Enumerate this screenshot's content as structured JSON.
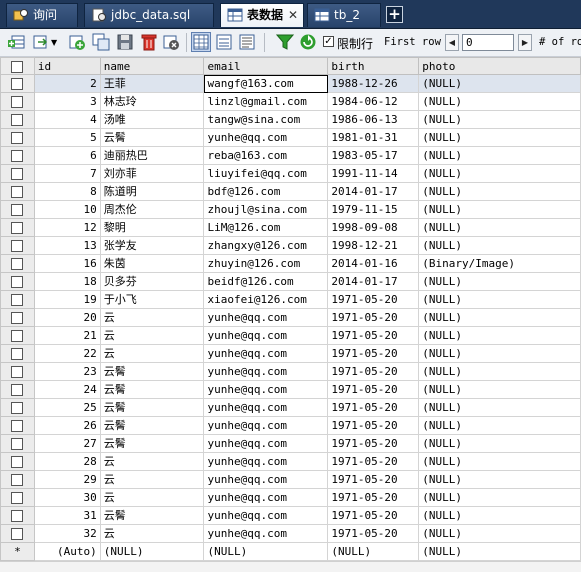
{
  "tabs": [
    {
      "label": "询问",
      "icon": "query-icon",
      "active": false
    },
    {
      "label": "jdbc_data.sql",
      "icon": "sql-file-icon",
      "active": false
    },
    {
      "label": "表数据",
      "icon": "table-data-icon",
      "active": true
    },
    {
      "label": "tb_2",
      "icon": "table-icon",
      "active": false
    }
  ],
  "toolbar": {
    "limit_label": "限制行",
    "first_row_label": "First row",
    "first_row_value": "0",
    "of_rows_label": "# of ro"
  },
  "columns": [
    "id",
    "name",
    "email",
    "birth",
    "photo"
  ],
  "rows": [
    {
      "id": "2",
      "name": "王菲",
      "email": "wangf@163.com",
      "birth": "1988-12-26",
      "photo": "(NULL)"
    },
    {
      "id": "3",
      "name": "林志玲",
      "email": "linzl@gmail.com",
      "birth": "1984-06-12",
      "photo": "(NULL)"
    },
    {
      "id": "4",
      "name": "汤唯",
      "email": "tangw@sina.com",
      "birth": "1986-06-13",
      "photo": "(NULL)"
    },
    {
      "id": "5",
      "name": "云鬌",
      "email": "yunhe@qq.com",
      "birth": "1981-01-31",
      "photo": "(NULL)"
    },
    {
      "id": "6",
      "name": "迪丽热巴",
      "email": "reba@163.com",
      "birth": "1983-05-17",
      "photo": "(NULL)"
    },
    {
      "id": "7",
      "name": "刘亦菲",
      "email": "liuyifei@qq.com",
      "birth": "1991-11-14",
      "photo": "(NULL)"
    },
    {
      "id": "8",
      "name": "陈道明",
      "email": "bdf@126.com",
      "birth": "2014-01-17",
      "photo": "(NULL)"
    },
    {
      "id": "10",
      "name": "周杰伦",
      "email": "zhoujl@sina.com",
      "birth": "1979-11-15",
      "photo": "(NULL)"
    },
    {
      "id": "12",
      "name": "黎明",
      "email": "LiM@126.com",
      "birth": "1998-09-08",
      "photo": "(NULL)"
    },
    {
      "id": "13",
      "name": "张学友",
      "email": "zhangxy@126.com",
      "birth": "1998-12-21",
      "photo": "(NULL)"
    },
    {
      "id": "16",
      "name": "朱茵",
      "email": "zhuyin@126.com",
      "birth": "2014-01-16",
      "photo": "(Binary/Image)"
    },
    {
      "id": "18",
      "name": "贝多芬",
      "email": "beidf@126.com",
      "birth": "2014-01-17",
      "photo": "(NULL)"
    },
    {
      "id": "19",
      "name": "于小飞",
      "email": "xiaofei@126.com",
      "birth": "1971-05-20",
      "photo": "(NULL)"
    },
    {
      "id": "20",
      "name": "云",
      "email": "yunhe@qq.com",
      "birth": "1971-05-20",
      "photo": "(NULL)"
    },
    {
      "id": "21",
      "name": "云",
      "email": "yunhe@qq.com",
      "birth": "1971-05-20",
      "photo": "(NULL)"
    },
    {
      "id": "22",
      "name": "云",
      "email": "yunhe@qq.com",
      "birth": "1971-05-20",
      "photo": "(NULL)"
    },
    {
      "id": "23",
      "name": "云鬌",
      "email": "yunhe@qq.com",
      "birth": "1971-05-20",
      "photo": "(NULL)"
    },
    {
      "id": "24",
      "name": "云鬌",
      "email": "yunhe@qq.com",
      "birth": "1971-05-20",
      "photo": "(NULL)"
    },
    {
      "id": "25",
      "name": "云鬌",
      "email": "yunhe@qq.com",
      "birth": "1971-05-20",
      "photo": "(NULL)"
    },
    {
      "id": "26",
      "name": "云鬌",
      "email": "yunhe@qq.com",
      "birth": "1971-05-20",
      "photo": "(NULL)"
    },
    {
      "id": "27",
      "name": "云鬌",
      "email": "yunhe@qq.com",
      "birth": "1971-05-20",
      "photo": "(NULL)"
    },
    {
      "id": "28",
      "name": "云",
      "email": "yunhe@qq.com",
      "birth": "1971-05-20",
      "photo": "(NULL)"
    },
    {
      "id": "29",
      "name": "云",
      "email": "yunhe@qq.com",
      "birth": "1971-05-20",
      "photo": "(NULL)"
    },
    {
      "id": "30",
      "name": "云",
      "email": "yunhe@qq.com",
      "birth": "1971-05-20",
      "photo": "(NULL)"
    },
    {
      "id": "31",
      "name": "云鬌",
      "email": "yunhe@qq.com",
      "birth": "1971-05-20",
      "photo": "(NULL)"
    },
    {
      "id": "32",
      "name": "云",
      "email": "yunhe@qq.com",
      "birth": "1971-05-20",
      "photo": "(NULL)"
    }
  ],
  "new_row": {
    "marker": "*",
    "id": "(Auto)",
    "name": "(NULL)",
    "email": "(NULL)",
    "birth": "(NULL)",
    "photo": "(NULL)"
  }
}
